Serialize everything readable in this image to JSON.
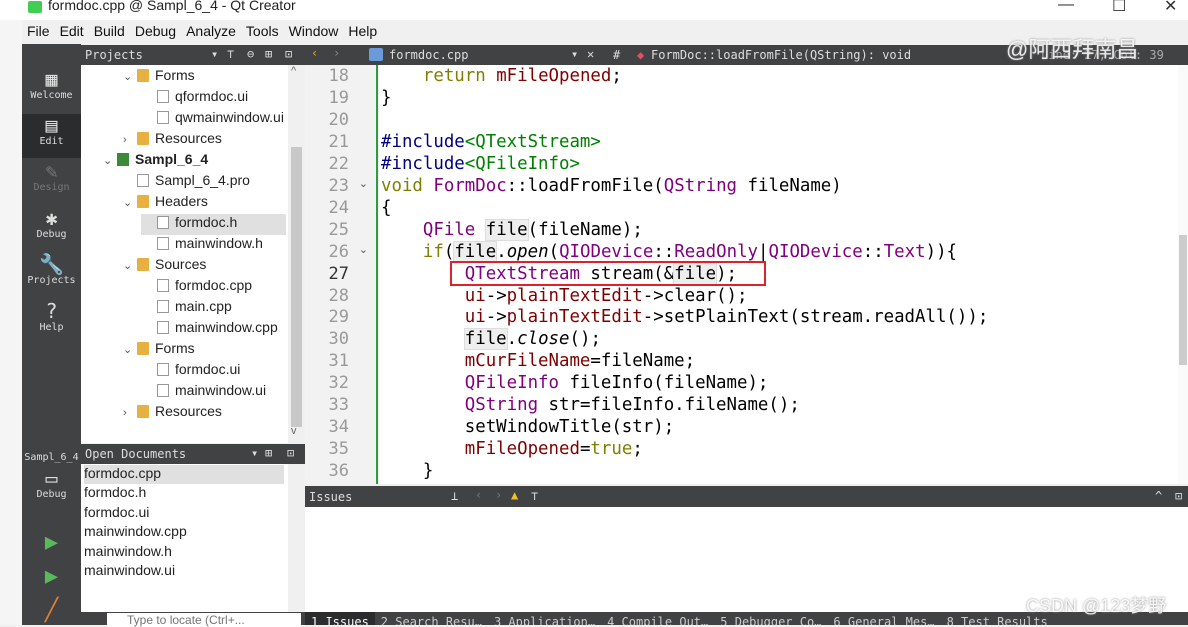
{
  "window": {
    "title": "formdoc.cpp @ Sampl_6_4 - Qt Creator",
    "minimize": "—",
    "maximize": "☐",
    "close": "✕"
  },
  "menu": [
    "File",
    "Edit",
    "Build",
    "Debug",
    "Analyze",
    "Tools",
    "Window",
    "Help"
  ],
  "modes": [
    {
      "label": "Welcome",
      "icon": "grid-icon",
      "glyph": "▦"
    },
    {
      "label": "Edit",
      "icon": "edit-icon",
      "glyph": "▤"
    },
    {
      "label": "Design",
      "icon": "pencil-icon",
      "glyph": "✎"
    },
    {
      "label": "Debug",
      "icon": "bug-icon",
      "glyph": "✱"
    },
    {
      "label": "Projects",
      "icon": "wrench-icon",
      "glyph": "🔧"
    },
    {
      "label": "Help",
      "icon": "help-icon",
      "glyph": "?"
    }
  ],
  "kit": {
    "project": "Sampl_6_4",
    "mode": "Debug"
  },
  "projects": {
    "title": "Projects",
    "tree": [
      {
        "label": "Forms",
        "type": "folder",
        "level": 1,
        "arrow": "v"
      },
      {
        "label": "qformdoc.ui",
        "type": "file",
        "level": 2
      },
      {
        "label": "qwmainwindow.ui",
        "type": "file",
        "level": 2
      },
      {
        "label": "Resources",
        "type": "folder",
        "level": 1,
        "arrow": ">"
      },
      {
        "label": "Sampl_6_4",
        "type": "project",
        "level": 0,
        "arrow": "v"
      },
      {
        "label": "Sampl_6_4.pro",
        "type": "file",
        "level": 1
      },
      {
        "label": "Headers",
        "type": "folder",
        "level": 1,
        "arrow": "v"
      },
      {
        "label": "formdoc.h",
        "type": "file",
        "level": 2,
        "selected": true
      },
      {
        "label": "mainwindow.h",
        "type": "file",
        "level": 2
      },
      {
        "label": "Sources",
        "type": "folder",
        "level": 1,
        "arrow": "v"
      },
      {
        "label": "formdoc.cpp",
        "type": "file",
        "level": 2
      },
      {
        "label": "main.cpp",
        "type": "file",
        "level": 2
      },
      {
        "label": "mainwindow.cpp",
        "type": "file",
        "level": 2
      },
      {
        "label": "Forms",
        "type": "folder",
        "level": 1,
        "arrow": "v"
      },
      {
        "label": "formdoc.ui",
        "type": "file",
        "level": 2
      },
      {
        "label": "mainwindow.ui",
        "type": "file",
        "level": 2
      },
      {
        "label": "Resources",
        "type": "folder",
        "level": 1,
        "arrow": ">"
      }
    ]
  },
  "open_documents": {
    "title": "Open Documents",
    "items": [
      "formdoc.cpp",
      "formdoc.h",
      "formdoc.ui",
      "mainwindow.cpp",
      "mainwindow.h",
      "mainwindow.ui"
    ]
  },
  "locate": {
    "placeholder": "Type to locate (Ctrl+..."
  },
  "editor": {
    "file": "formdoc.cpp",
    "hash": "#",
    "symbol": "FormDoc::loadFromFile(QString): void",
    "position": "Line: 27, Col: 39",
    "current_line": 27,
    "lines": [
      {
        "n": 18,
        "t": [
          [
            "    ",
            ""
          ],
          [
            "return",
            "kw"
          ],
          [
            " ",
            ""
          ],
          [
            "mFileOpened",
            "mb"
          ],
          [
            ";",
            ""
          ]
        ]
      },
      {
        "n": 19,
        "t": [
          [
            "}",
            ""
          ]
        ]
      },
      {
        "n": 20,
        "t": []
      },
      {
        "n": 21,
        "t": [
          [
            "#include",
            "pp"
          ],
          [
            "<QTextStream>",
            "inc"
          ]
        ]
      },
      {
        "n": 22,
        "t": [
          [
            "#include",
            "pp"
          ],
          [
            "<QFileInfo>",
            "inc"
          ]
        ]
      },
      {
        "n": 23,
        "fold": true,
        "t": [
          [
            "void",
            "kw"
          ],
          [
            " ",
            ""
          ],
          [
            "FormDoc",
            "ty"
          ],
          [
            "::loadFromFile(",
            ""
          ],
          [
            "QString",
            "ty"
          ],
          [
            " fileName)",
            ""
          ]
        ]
      },
      {
        "n": 24,
        "t": [
          [
            "{",
            ""
          ]
        ]
      },
      {
        "n": 25,
        "t": [
          [
            "    ",
            ""
          ],
          [
            "QFile",
            "ty"
          ],
          [
            " ",
            ""
          ],
          [
            "file",
            "hl"
          ],
          [
            "(fileName);",
            ""
          ]
        ]
      },
      {
        "n": 26,
        "fold": true,
        "t": [
          [
            "    ",
            ""
          ],
          [
            "if",
            "kw"
          ],
          [
            "(",
            ""
          ],
          [
            "file",
            "hl"
          ],
          [
            ".",
            ""
          ],
          [
            "open",
            "it"
          ],
          [
            "(",
            ""
          ],
          [
            "QIODevice",
            "ty"
          ],
          [
            "::",
            ""
          ],
          [
            "ReadOnly",
            "en"
          ],
          [
            "|",
            ""
          ],
          [
            "QIODevice",
            "ty"
          ],
          [
            "::",
            ""
          ],
          [
            "Text",
            "en"
          ],
          [
            ")){",
            ""
          ]
        ]
      },
      {
        "n": 27,
        "t": [
          [
            "        ",
            ""
          ],
          [
            "QTextStream",
            "ty"
          ],
          [
            " stream(&",
            ""
          ],
          [
            "file",
            "hl"
          ],
          [
            ");",
            ""
          ]
        ]
      },
      {
        "n": 28,
        "t": [
          [
            "        ",
            ""
          ],
          [
            "ui",
            "mb"
          ],
          [
            "->",
            ""
          ],
          [
            "plainTextEdit",
            "mb"
          ],
          [
            "->clear();",
            ""
          ]
        ]
      },
      {
        "n": 29,
        "t": [
          [
            "        ",
            ""
          ],
          [
            "ui",
            "mb"
          ],
          [
            "->",
            ""
          ],
          [
            "plainTextEdit",
            "mb"
          ],
          [
            "->setPlainText(stream.readAll());",
            ""
          ]
        ]
      },
      {
        "n": 30,
        "t": [
          [
            "        ",
            ""
          ],
          [
            "file",
            "hl"
          ],
          [
            ".",
            ""
          ],
          [
            "close",
            "it"
          ],
          [
            "();",
            ""
          ]
        ]
      },
      {
        "n": 31,
        "t": [
          [
            "        ",
            ""
          ],
          [
            "mCurFileName",
            "mb"
          ],
          [
            "=fileName;",
            ""
          ]
        ]
      },
      {
        "n": 32,
        "t": [
          [
            "        ",
            ""
          ],
          [
            "QFileInfo",
            "ty"
          ],
          [
            " fileInfo(fileName);",
            ""
          ]
        ]
      },
      {
        "n": 33,
        "t": [
          [
            "        ",
            ""
          ],
          [
            "QString",
            "ty"
          ],
          [
            " str=fileInfo.fileName();",
            ""
          ]
        ]
      },
      {
        "n": 34,
        "t": [
          [
            "        setWindowTitle(str);",
            ""
          ]
        ]
      },
      {
        "n": 35,
        "t": [
          [
            "        ",
            ""
          ],
          [
            "mFileOpened",
            "mb"
          ],
          [
            "=",
            ""
          ],
          [
            "true",
            "kw"
          ],
          [
            ";",
            ""
          ]
        ]
      },
      {
        "n": 36,
        "t": [
          [
            "    }",
            ""
          ]
        ]
      }
    ]
  },
  "issues": {
    "title": "Issues"
  },
  "bottom_tabs": [
    "1 Issues",
    "2 Search Resu…",
    "3 Application…",
    "4 Compile Out…",
    "5 Debugger Co…",
    "6 General Mes…",
    "8 Test Results"
  ],
  "watermarks": {
    "top": "@阿西拜南昌",
    "bottom": "CSDN @123梦野"
  },
  "colors": {
    "highlight_box": "#e0202a",
    "mode_bar": "#404244",
    "gutter_border": "#2e9b3e"
  }
}
